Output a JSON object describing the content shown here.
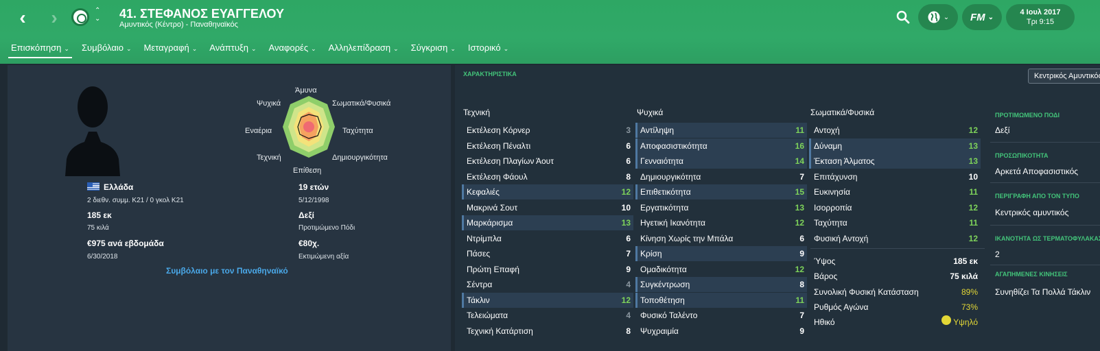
{
  "header": {
    "player_title": "41. ΣΤΕΦΑΝΟΣ ΕΥΑΓΓΕΛΟΥ",
    "player_subtitle": "Αμυντικός (Κέντρο) - Παναθηναϊκός",
    "date": "4 Ιουλ 2017",
    "day_time": "Τρι 9:15",
    "fm_label": "FM"
  },
  "tabs": [
    {
      "label": "Επισκόπηση"
    },
    {
      "label": "Συμβόλαιο"
    },
    {
      "label": "Μεταγραφή"
    },
    {
      "label": "Ανάπτυξη"
    },
    {
      "label": "Αναφορές"
    },
    {
      "label": "Αλληλεπίδραση"
    },
    {
      "label": "Σύγκριση"
    },
    {
      "label": "Ιστορικό"
    }
  ],
  "radar": {
    "top": "Άμυνα",
    "top_right": "Σωματικά/Φυσικά",
    "right": "Ταχύτητα",
    "bottom_right": "Δημιουργικότητα",
    "bottom": "Επίθεση",
    "bottom_left": "Τεχνική",
    "left": "Εναέρια",
    "top_left": "Ψυχικά"
  },
  "profile": {
    "nationality": "Ελλάδα",
    "caps": "2 διεθν. συμμ. Κ21 / 0 γκολ Κ21",
    "age": "19 ετών",
    "dob": "5/12/1998",
    "height": "185 εκ",
    "weight": "75 κιλά",
    "foot": "Δεξί",
    "foot_label": "Προτιμώμενο Πόδι",
    "wage": "€975 ανά εβδομάδα",
    "contract_end": "6/30/2018",
    "value": "€80χ.",
    "value_label": "Εκτιμώμενη αξία",
    "contract_link": "Συμβόλαιο με τον Παναθηναϊκό"
  },
  "attributes": {
    "title": "ΧΑΡΑΚΤΗΡΙΣΤΙΚΑ",
    "position_button": "Κεντρικός Αμυντικός",
    "technical_title": "Τεχνική",
    "mental_title": "Ψυχικά",
    "physical_title": "Σωματικά/Φυσικά",
    "technical": [
      {
        "name": "Εκτέλεση Κόρνερ",
        "value": "3"
      },
      {
        "name": "Εκτέλεση Πέναλτι",
        "value": "6"
      },
      {
        "name": "Εκτέλεση Πλαγίων Άουτ",
        "value": "6"
      },
      {
        "name": "Εκτέλεση Φάουλ",
        "value": "8"
      },
      {
        "name": "Κεφαλιές",
        "value": "12"
      },
      {
        "name": "Μακρινά Σουτ",
        "value": "10"
      },
      {
        "name": "Μαρκάρισμα",
        "value": "13"
      },
      {
        "name": "Ντρίμπλα",
        "value": "6"
      },
      {
        "name": "Πάσες",
        "value": "7"
      },
      {
        "name": "Πρώτη Επαφή",
        "value": "9"
      },
      {
        "name": "Σέντρα",
        "value": "4"
      },
      {
        "name": "Τάκλιν",
        "value": "12"
      },
      {
        "name": "Τελειώματα",
        "value": "4"
      },
      {
        "name": "Τεχνική Κατάρτιση",
        "value": "8"
      }
    ],
    "mental": [
      {
        "name": "Αντίληψη",
        "value": "11"
      },
      {
        "name": "Αποφασιστικότητα",
        "value": "16"
      },
      {
        "name": "Γενναιότητα",
        "value": "14"
      },
      {
        "name": "Δημιουργικότητα",
        "value": "7"
      },
      {
        "name": "Επιθετικότητα",
        "value": "15"
      },
      {
        "name": "Εργατικότητα",
        "value": "13"
      },
      {
        "name": "Ηγετική Ικανότητα",
        "value": "12"
      },
      {
        "name": "Κίνηση Χωρίς την Μπάλα",
        "value": "6"
      },
      {
        "name": "Κρίση",
        "value": "9"
      },
      {
        "name": "Ομαδικότητα",
        "value": "12"
      },
      {
        "name": "Συγκέντρωση",
        "value": "8"
      },
      {
        "name": "Τοποθέτηση",
        "value": "11"
      },
      {
        "name": "Φυσικό Ταλέντο",
        "value": "7"
      },
      {
        "name": "Ψυχραιμία",
        "value": "9"
      }
    ],
    "physical": [
      {
        "name": "Αντοχή",
        "value": "12"
      },
      {
        "name": "Δύναμη",
        "value": "13"
      },
      {
        "name": "Έκταση Άλματος",
        "value": "13"
      },
      {
        "name": "Επιτάχυνση",
        "value": "10"
      },
      {
        "name": "Ευκινησία",
        "value": "11"
      },
      {
        "name": "Ισορροπία",
        "value": "12"
      },
      {
        "name": "Ταχύτητα",
        "value": "11"
      },
      {
        "name": "Φυσική Αντοχή",
        "value": "12"
      }
    ],
    "fitness": [
      {
        "name": "Ύψος",
        "value": "185 εκ"
      },
      {
        "name": "Βάρος",
        "value": "75 κιλά"
      },
      {
        "name": "Συνολική Φυσική Κατάσταση",
        "value": "89%"
      },
      {
        "name": "Ρυθμός Αγώνα",
        "value": "73%"
      },
      {
        "name": "Ηθικό",
        "value": "Υψηλό"
      }
    ]
  },
  "side": {
    "foot_h": "ΠΡΟΤΙΜΩΜΕΝΟ ΠΟΔΙ",
    "foot_v": "Δεξί",
    "personality_h": "ΠΡΟΣΩΠΙΚΟΤΗΤΑ",
    "personality_v": "Αρκετά Αποφασιστικός",
    "desc_h": "ΠΕΡΙΓΡΑΦΗ ΑΠΟ ΤΟΝ ΤΥΠΟ",
    "desc_v": "Κεντρικός αμυντικός",
    "ability_h": "ΙΚΑΝΟΤΗΤΑ ΩΣ ΤΕΡΜΑΤΟΦΥΛΑΚΑΣ",
    "ability_v": "2",
    "moves_h": "ΑΓΑΠΗΜΕΝΕΣ ΚΙΝΗΣΕΙΣ",
    "moves_v": "Συνηθίζει Τα Πολλά Τάκλιν"
  },
  "colors": {
    "header_green": "#2ea764",
    "accent_green": "#43c47a",
    "value_green": "#7ed35a",
    "link_blue": "#4aa8e8",
    "morale_yellow": "#e3d736"
  }
}
